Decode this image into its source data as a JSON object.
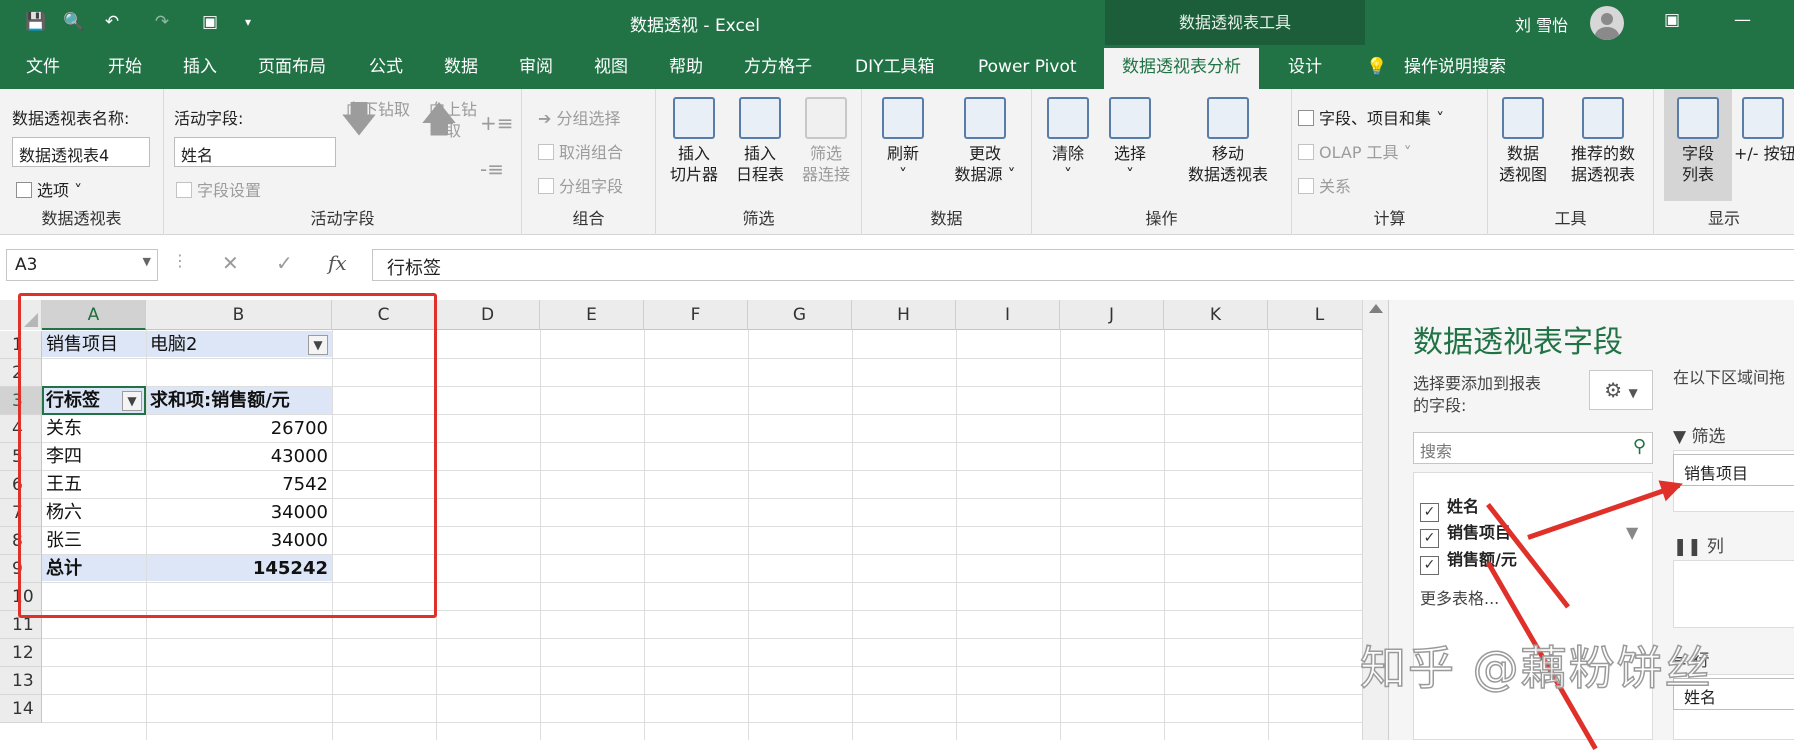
{
  "titlebar": {
    "title": "数据透视  -  Excel",
    "context_tools": "数据透视表工具",
    "user": "刘 雪怡"
  },
  "tabs": [
    "文件",
    "开始",
    "插入",
    "页面布局",
    "公式",
    "数据",
    "审阅",
    "视图",
    "帮助",
    "方方格子",
    "DIY工具箱",
    "Power Pivot",
    "数据透视表分析",
    "设计",
    "操作说明搜索"
  ],
  "ribbon": {
    "pivot": {
      "name_label": "数据透视表名称:",
      "name_value": "数据透视表4",
      "options": "选项",
      "group": "数据透视表"
    },
    "active_field": {
      "label": "活动字段:",
      "value": "姓名",
      "settings": "字段设置",
      "drill_down": "向下钻取",
      "drill_up_1": "向上钻",
      "drill_up_2": "取",
      "group": "活动字段"
    },
    "grouping": {
      "group_selection": "分组选择",
      "ungroup": "取消组合",
      "group_field": "分组字段",
      "group": "组合"
    },
    "filter": {
      "slicer_1": "插入",
      "slicer_2": "切片器",
      "timeline_1": "插入",
      "timeline_2": "日程表",
      "conn_1": "筛选",
      "conn_2": "器连接",
      "group": "筛选"
    },
    "data": {
      "refresh": "刷新",
      "change_1": "更改",
      "change_2": "数据源",
      "group": "数据"
    },
    "actions": {
      "clear": "清除",
      "select": "选择",
      "move_1": "移动",
      "move_2": "数据透视表",
      "group": "操作"
    },
    "calc": {
      "fields_items": "字段、项目和集",
      "olap": "OLAP 工具",
      "relations": "关系",
      "group": "计算"
    },
    "tools": {
      "chart_1": "数据",
      "chart_2": "透视图",
      "rec_1": "推荐的数",
      "rec_2": "据透视表",
      "group": "工具"
    },
    "show": {
      "fieldlist_1": "字段",
      "fieldlist_2": "列表",
      "buttons": "+/- 按钮",
      "group": "显示"
    }
  },
  "formula": {
    "namebox": "A3",
    "content": "行标签"
  },
  "columns": [
    "A",
    "B",
    "C",
    "D",
    "E",
    "F",
    "G",
    "H",
    "I",
    "J",
    "K",
    "L"
  ],
  "rows": [
    "1",
    "2",
    "3",
    "4",
    "5",
    "6",
    "7",
    "8",
    "9",
    "10",
    "11",
    "12",
    "13",
    "14"
  ],
  "sheet": {
    "filter_label": "销售项目",
    "filter_value": "电脑2",
    "row_label": "行标签",
    "sum_label": "求和项:销售额/元",
    "data": [
      {
        "name": "关东",
        "value": "26700"
      },
      {
        "name": "李四",
        "value": "43000"
      },
      {
        "name": "王五",
        "value": "7542"
      },
      {
        "name": "杨六",
        "value": "34000"
      },
      {
        "name": "张三",
        "value": "34000"
      }
    ],
    "total_label": "总计",
    "total_value": "145242"
  },
  "pane": {
    "title": "数据透视表字段",
    "choose_1": "选择要添加到报表",
    "choose_2": "的字段:",
    "drag_label": "在以下区域间拖",
    "search_placeholder": "搜索",
    "fields": [
      "姓名",
      "销售项目",
      "销售额/元"
    ],
    "more_tables": "更多表格...",
    "filters_label": "筛选",
    "filters_item": "销售项目",
    "columns_label": "列",
    "rows_label": "行",
    "rows_item": "姓名"
  },
  "watermark": "知乎 @藕粉饼丝"
}
